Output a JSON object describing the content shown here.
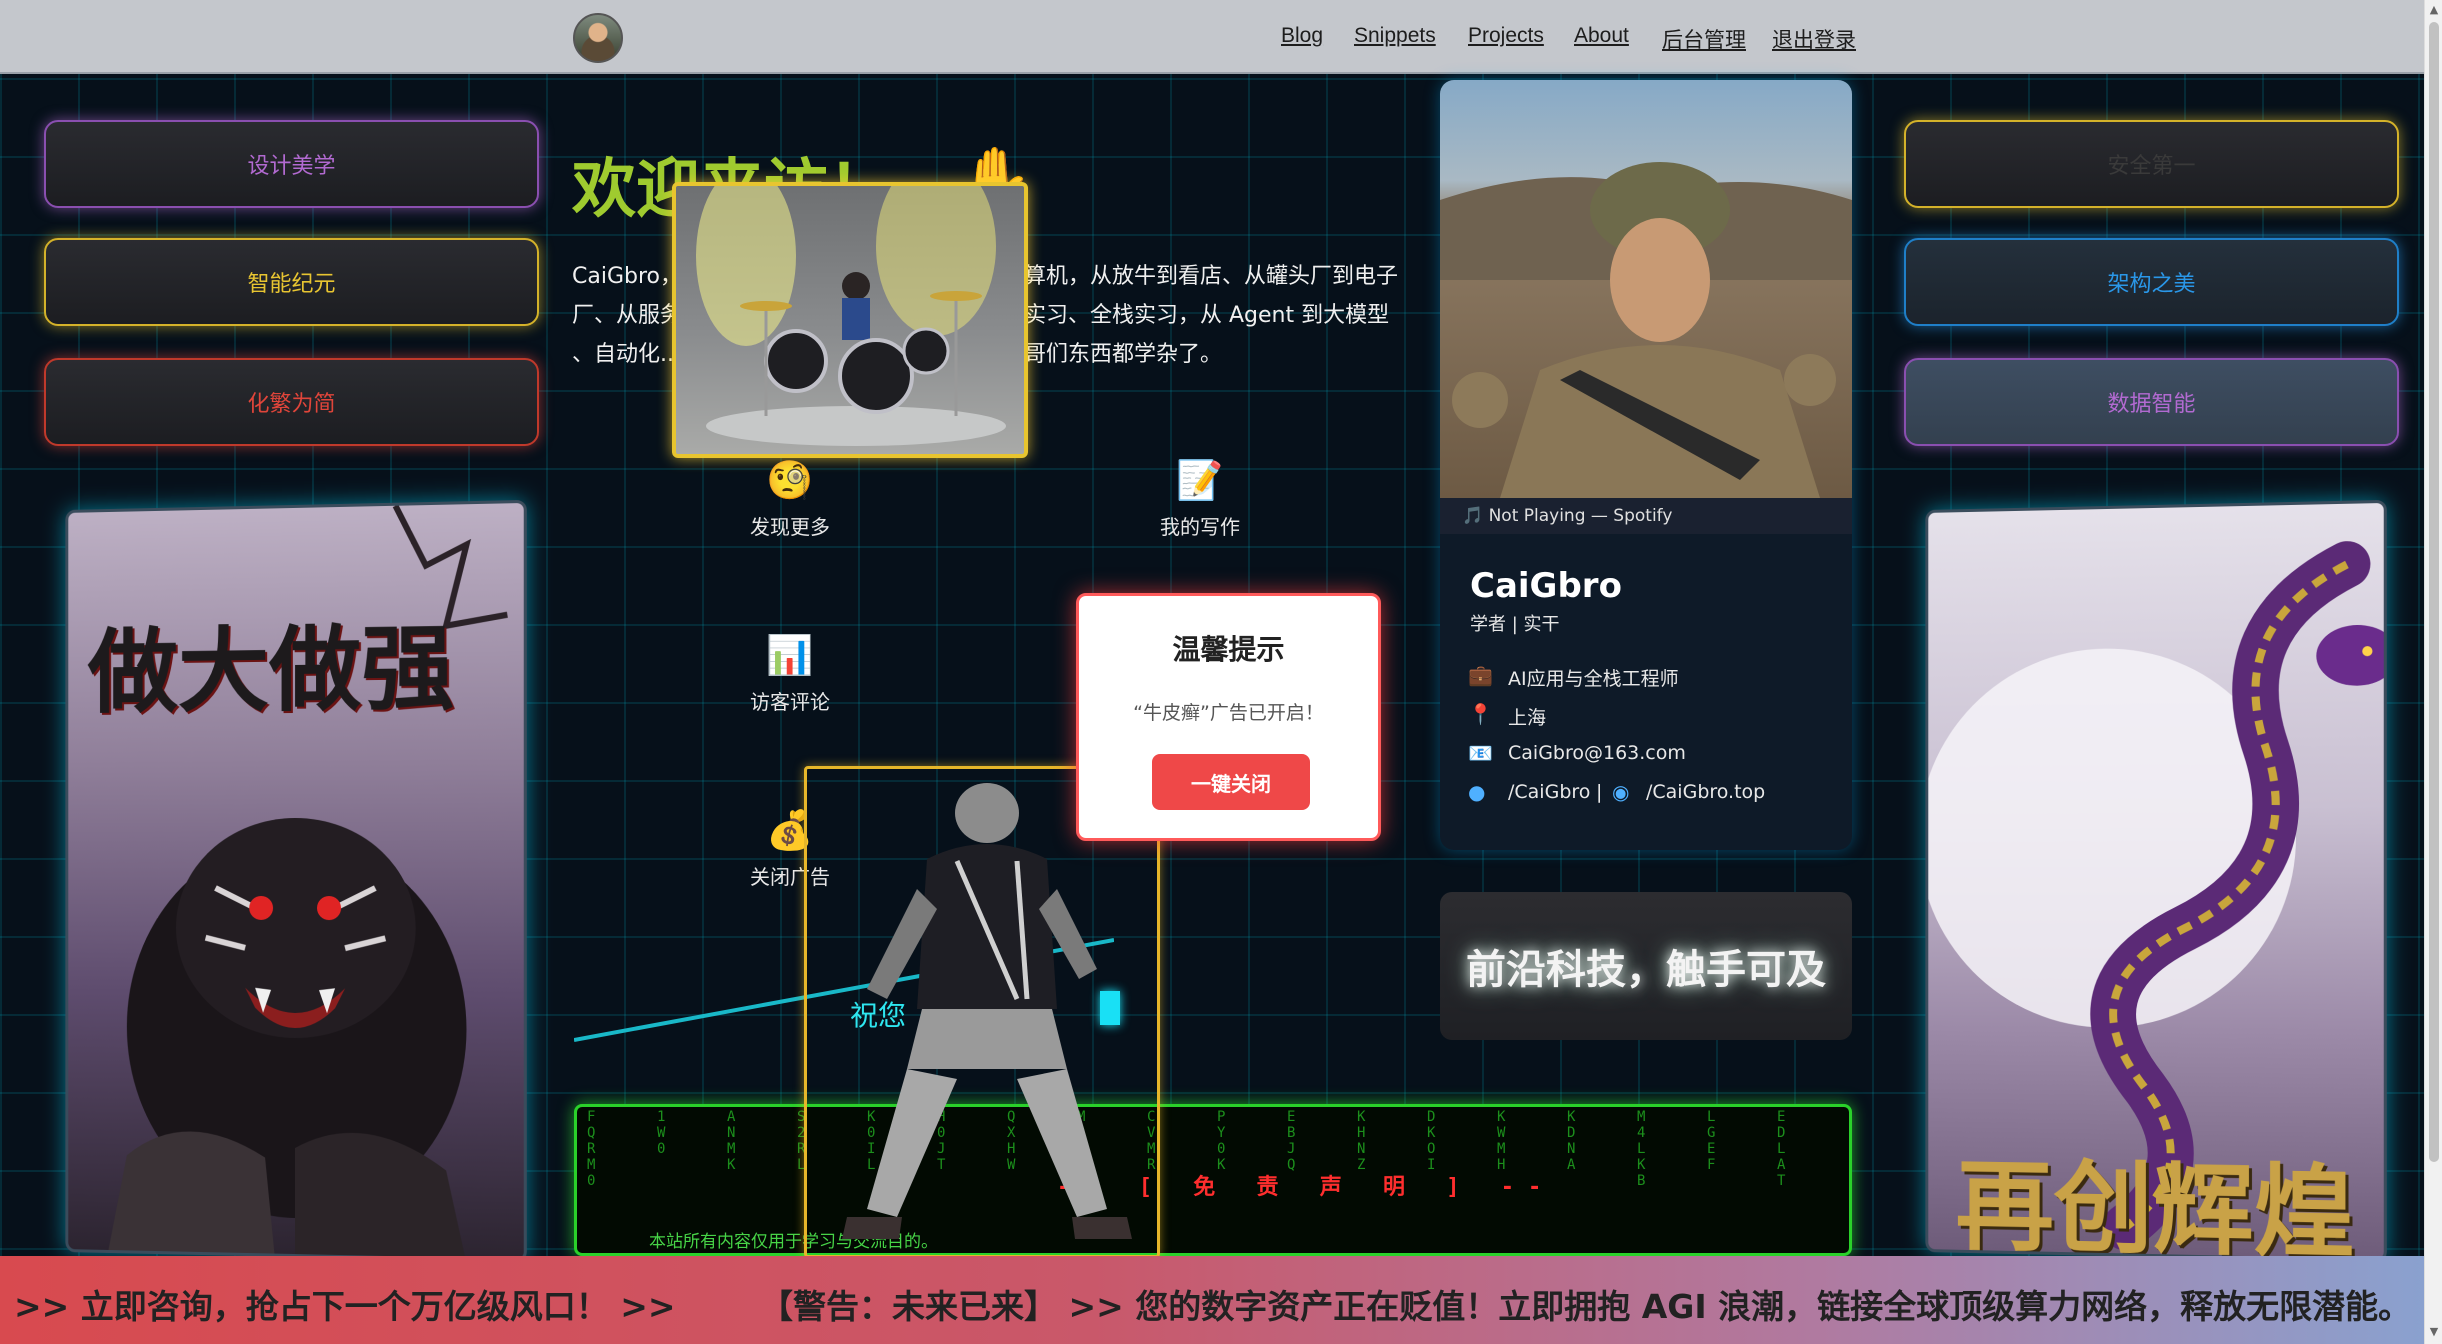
{
  "nav": {
    "links": [
      "Blog",
      "Snippets",
      "Projects",
      "About",
      "后台管理",
      "退出登录"
    ]
  },
  "left_buttons": [
    {
      "label": "设计美学",
      "color": "#b26ad1"
    },
    {
      "label": "智能纪元",
      "color": "#e8c531"
    },
    {
      "label": "化繁为简",
      "color": "#e0453a"
    }
  ],
  "right_buttons": [
    {
      "label": "安全第一",
      "color": "#e8c531"
    },
    {
      "label": "架构之美",
      "color": "#2a97e8"
    },
    {
      "label": "数据智能",
      "color": "#b26ad1"
    }
  ],
  "posters": {
    "left_title": "做大做强",
    "right_title": "再创辉煌"
  },
  "welcome": {
    "title": "欢迎来访！",
    "wave_icon": "waving-hand-icon",
    "intro_lines": [
      "CaiGbro，",
      "算机，从放牛到看店、从罐头厂到电子",
      "厂、从服务",
      "实习、全栈实习，从 Agent 到大模型",
      "、自动化...",
      "哥们东西都学杂了。"
    ]
  },
  "features": [
    {
      "label": "发现更多",
      "icon": "🧐"
    },
    {
      "label": "我的写作",
      "icon": "📝"
    },
    {
      "label": "访客评论",
      "icon": "📊"
    },
    {
      "label": "关闭广告",
      "icon": "💰"
    }
  ],
  "profile": {
    "spotify": "🎵 Not Playing — Spotify",
    "name": "CaiGbro",
    "subtitle": "学者 | 实干",
    "role": "AI应用与全栈工程师",
    "location": "上海",
    "email": "CaiGbro@163.com",
    "github": "/CaiGbro",
    "separator": "|",
    "website": "/CaiGbro.top"
  },
  "tech_slogan": "前沿科技，触手可及",
  "modal": {
    "title": "温馨提示",
    "message": "“牛皮癣”广告已开启！",
    "button": "一键关闭"
  },
  "wish_text": "祝您",
  "disclaimer": {
    "title": "-- [ 免 责 声 明 ] --",
    "text": "本站所有内容仅用于学习与交流目的。"
  },
  "ticker": {
    "segment1": ">> 立即咨询，抢占下一个万亿级风口！ >>",
    "segment2": "【警告：未来已来】 >> 您的数字资产正在贬值！立即拥抱 AGI 浪潮，链接全球顶级算力网络，释放无限潜能。 >> 立"
  },
  "matrix_columns": [
    "FQRM0",
    "1W0",
    "ANMK",
    "S2RL",
    "K0IL",
    "H0JT",
    "QXHW",
    "M2SJO",
    "CVMR",
    "PY0K",
    "EBJQ",
    "KHNZ",
    "DKOI",
    "KWMH",
    "KDNA",
    "M4LKB",
    "LGEF",
    "EDLAT"
  ]
}
